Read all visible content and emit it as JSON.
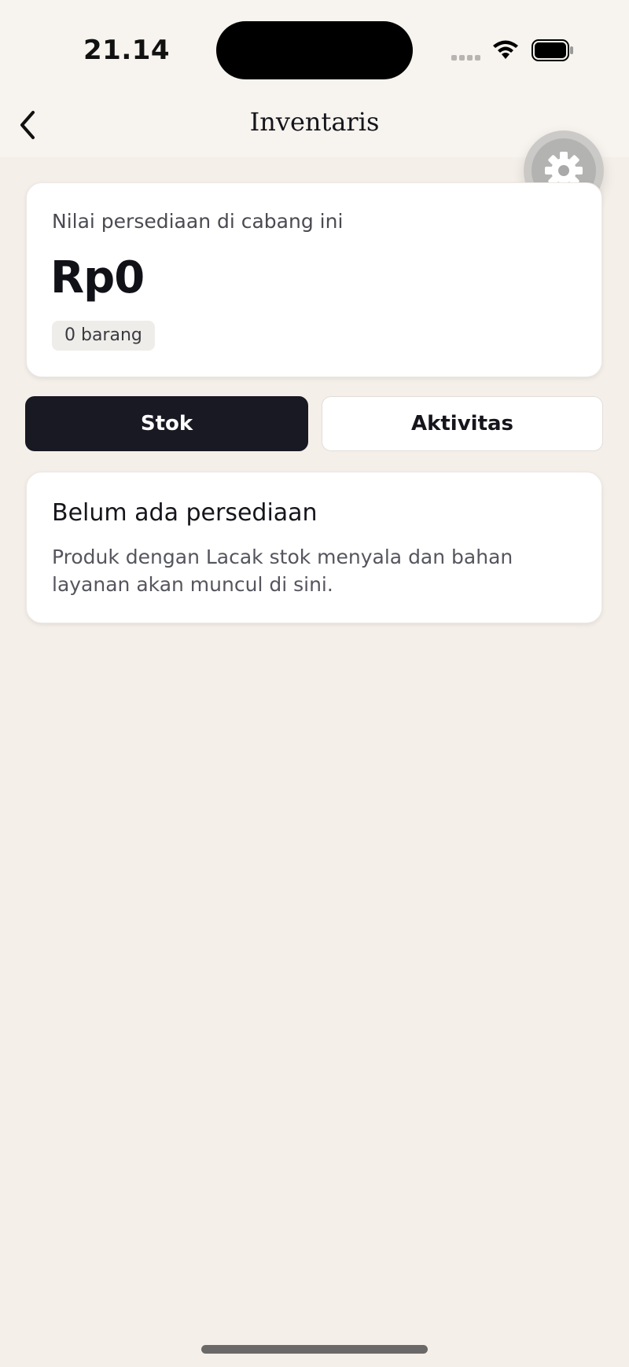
{
  "status_bar": {
    "time": "21.14",
    "icons": [
      "signal-dots-icon",
      "wifi-icon",
      "battery-icon"
    ]
  },
  "nav": {
    "title": "Inventaris",
    "back_icon": "chevron-left-icon"
  },
  "settings_button": {
    "icon": "gear-icon"
  },
  "summary": {
    "label": "Nilai persediaan di cabang ini",
    "amount": "Rp0",
    "badge": "0 barang"
  },
  "tabs": [
    {
      "label": "Stok",
      "selected": true
    },
    {
      "label": "Aktivitas",
      "selected": false
    }
  ],
  "empty_state": {
    "title": "Belum ada persediaan",
    "description": "Produk dengan Lacak stok menyala dan bahan layanan akan muncul di sini."
  },
  "colors": {
    "background": "#f5efe9",
    "primary_dark": "#181922",
    "card": "#ffffff"
  }
}
